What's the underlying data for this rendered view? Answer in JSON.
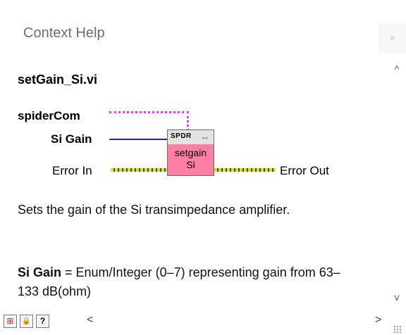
{
  "window": {
    "title": "Context Help",
    "close_label": "×"
  },
  "help": {
    "vi_name": "setGain_Si.vi",
    "terminals": {
      "spidercom": "spiderCom",
      "si_gain": "Si Gain",
      "error_in": "Error In",
      "error_out": "Error Out"
    },
    "icon": {
      "brand": "SPDR",
      "arrow_glyph": "↔",
      "line1": "setgain",
      "line2": "Si"
    },
    "description": "Sets the gain of the Si transimpedance amplifier.",
    "param_name": "Si Gain",
    "param_text": " = Enum/Integer (0–7) representing gain from 63–133 dB(ohm)"
  },
  "toolbar": {
    "show_optional_terminals_icon": "⊞",
    "lock_icon": "🔒",
    "help_glyph": "?",
    "scroll_left_glyph": "<",
    "scroll_right_glyph": ">",
    "scroll_up_glyph": "^",
    "scroll_down_glyph": "v"
  },
  "colors": {
    "dynamic_wire": "#ff2cff",
    "numeric_wire": "#1b1bff",
    "error_wire": "#dede2a",
    "icon_bottom": "#ff7fa3"
  }
}
